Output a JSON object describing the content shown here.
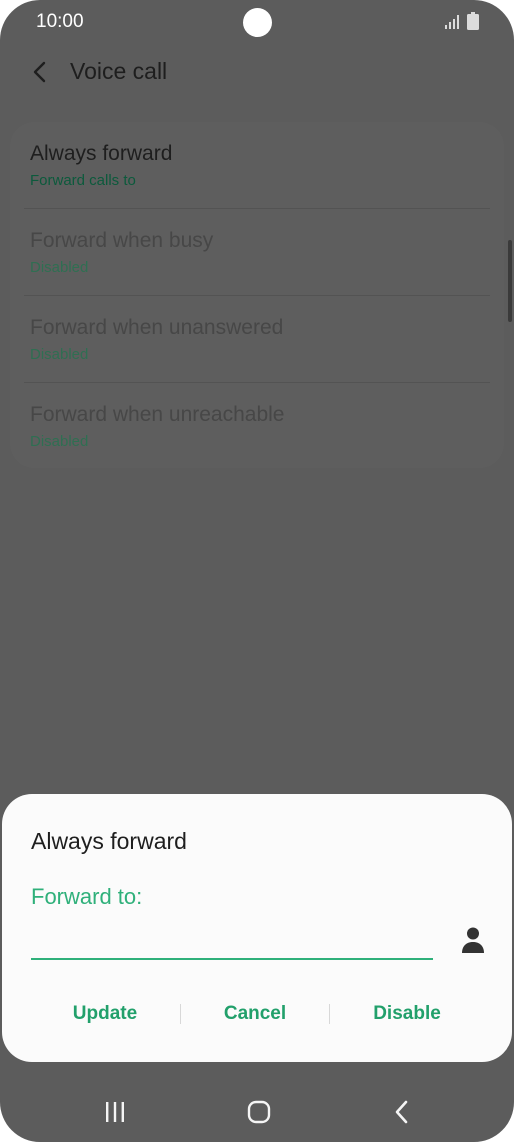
{
  "status_bar": {
    "time": "10:00"
  },
  "app_bar": {
    "title": "Voice call"
  },
  "settings": {
    "items": [
      {
        "title": "Always forward",
        "subtitle": "Forward calls to"
      },
      {
        "title": "Forward when busy",
        "subtitle": "Disabled"
      },
      {
        "title": "Forward when unanswered",
        "subtitle": "Disabled"
      },
      {
        "title": "Forward when unreachable",
        "subtitle": "Disabled"
      }
    ]
  },
  "dialog": {
    "title": "Always forward",
    "field_label": "Forward to:",
    "input_value": "",
    "buttons": {
      "update": "Update",
      "cancel": "Cancel",
      "disable": "Disable"
    }
  },
  "colors": {
    "accent": "#2fb07a",
    "scrim": "#5c5c5c",
    "dialog_bg": "#fbfbfb"
  },
  "icons": {
    "back": "chevron-left-icon",
    "contact": "person-icon",
    "nav_recents": "recents-icon",
    "nav_home": "home-icon",
    "nav_back": "back-icon"
  }
}
